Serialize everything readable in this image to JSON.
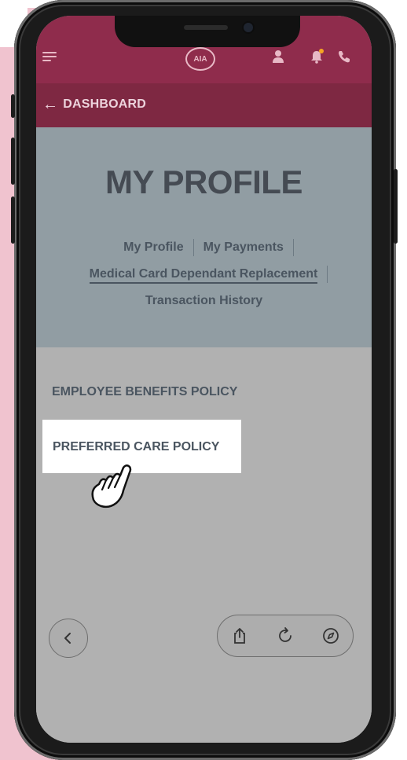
{
  "header": {
    "logo_text": "AIA",
    "back_label": "DASHBOARD"
  },
  "hero": {
    "title": "MY PROFILE",
    "tabs": [
      {
        "label": "My Profile",
        "active": false
      },
      {
        "label": "My Payments",
        "active": false
      },
      {
        "label": "Medical Card Dependant Replacement",
        "active": true
      },
      {
        "label": "Transaction History",
        "active": false
      }
    ]
  },
  "policies": [
    {
      "label": "EMPLOYEE BENEFITS POLICY",
      "highlighted": false
    },
    {
      "label": "PREFERRED CARE POLICY",
      "highlighted": true
    }
  ],
  "icons": [
    "menu-icon",
    "aia-logo",
    "profile-icon",
    "notification-bell-icon",
    "phone-icon",
    "back-arrow-icon",
    "pointer-hand-icon",
    "chevron-left-icon",
    "share-icon",
    "reload-icon",
    "compass-icon"
  ],
  "colors": {
    "brand": "#8f2c4c",
    "subbar": "#7e2842",
    "hero_bg": "#919da3",
    "text": "#4a5560",
    "notification_dot": "#f5a623"
  }
}
